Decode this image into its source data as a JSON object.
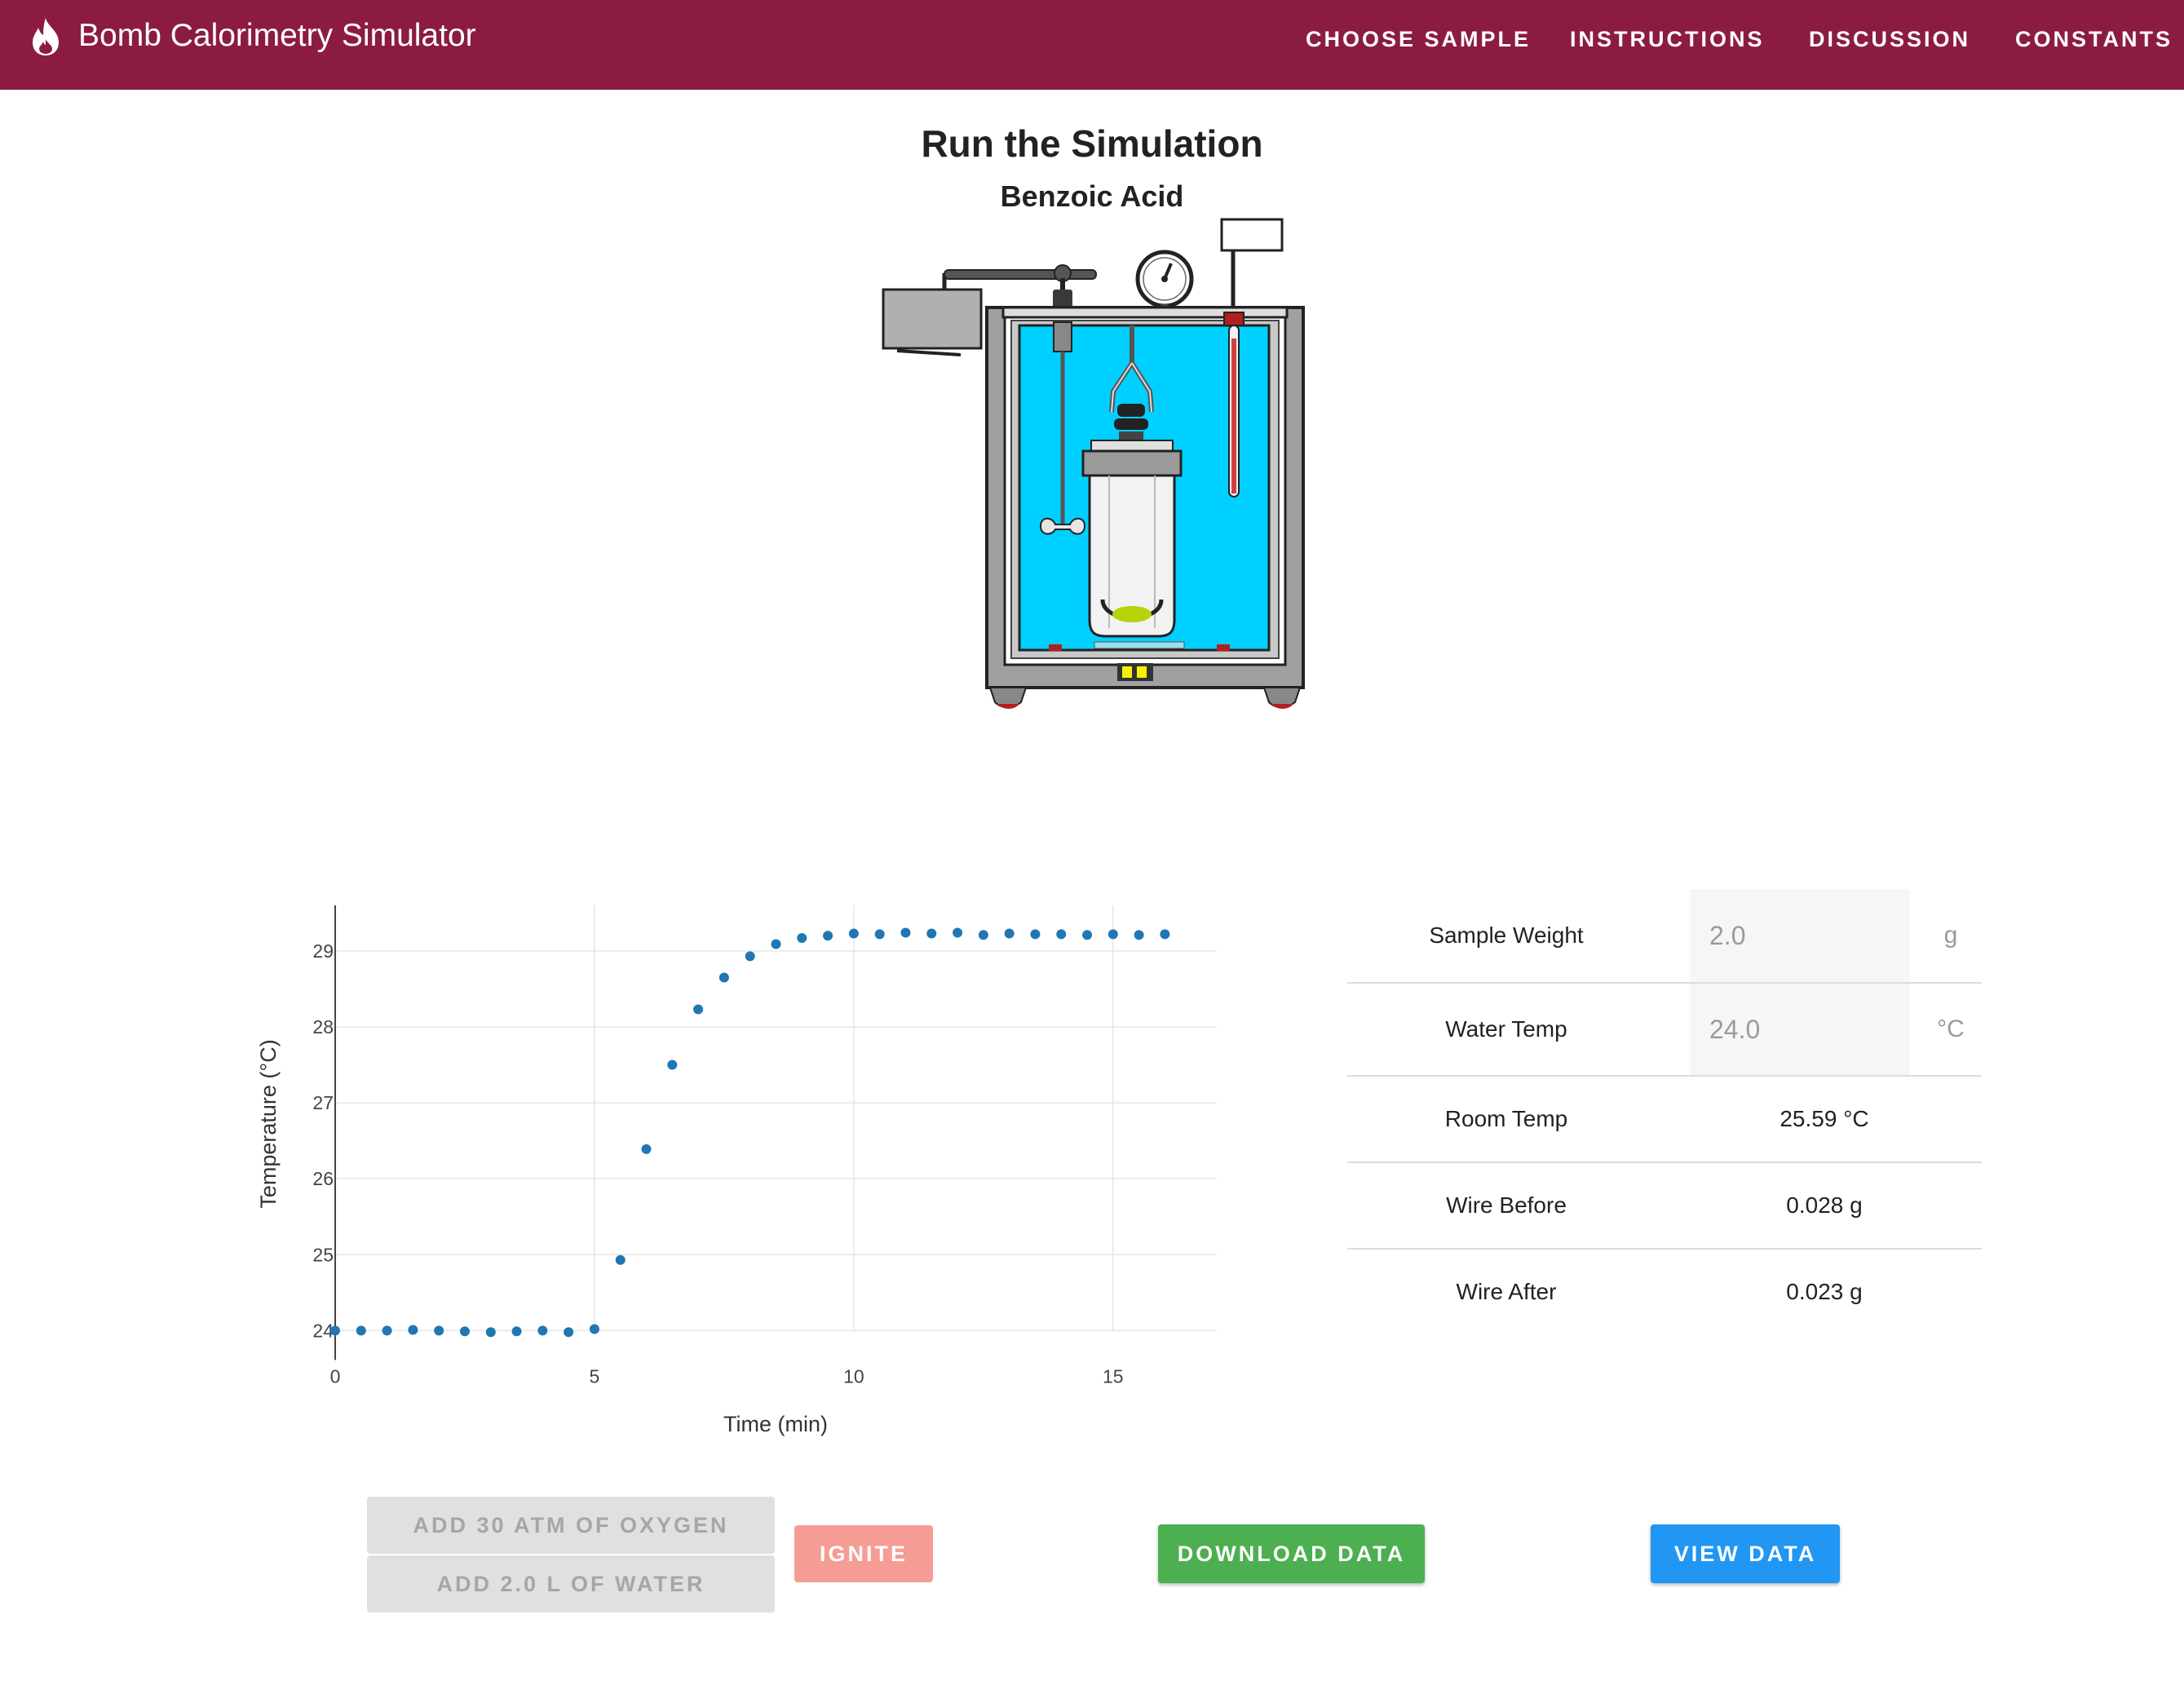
{
  "app": {
    "title": "Bomb Calorimetry Simulator",
    "brand_color": "#8b1c40",
    "logo_icon": "flame-icon"
  },
  "nav": {
    "items": [
      {
        "label": "CHOOSE SAMPLE"
      },
      {
        "label": "INSTRUCTIONS"
      },
      {
        "label": "DISCUSSION"
      },
      {
        "label": "CONSTANTS"
      }
    ]
  },
  "main": {
    "title": "Run the Simulation",
    "sample_name": "Benzoic Acid"
  },
  "chart_data": {
    "type": "scatter",
    "title": "",
    "xlabel": "Time (min)",
    "ylabel": "Temperature (°C)",
    "xlim": [
      0,
      17
    ],
    "ylim": [
      23.8,
      29.6
    ],
    "x_ticks": [
      0,
      5,
      10,
      15
    ],
    "y_ticks": [
      24,
      25,
      26,
      27,
      28,
      29
    ],
    "grid": true,
    "marker_color": "#1f77b4",
    "series": [
      {
        "x": [
          0,
          0.5,
          1,
          1.5,
          2,
          2.5,
          3,
          3.5,
          4,
          4.5,
          5,
          5.5,
          6,
          6.5,
          7,
          7.5,
          8,
          8.5,
          9,
          9.5,
          10,
          10.5,
          11,
          11.5,
          12,
          12.5,
          13,
          13.5,
          14,
          14.5,
          15,
          15.5,
          16
        ],
        "y": [
          24.0,
          24.0,
          24.0,
          24.01,
          24.0,
          23.99,
          23.98,
          23.99,
          24.0,
          23.98,
          24.02,
          24.93,
          26.39,
          27.5,
          28.23,
          28.65,
          28.93,
          29.09,
          29.17,
          29.2,
          29.23,
          29.22,
          29.24,
          29.23,
          29.24,
          29.21,
          29.23,
          29.22,
          29.22,
          29.21,
          29.22,
          29.21,
          29.22
        ]
      }
    ]
  },
  "params": {
    "sample_weight": {
      "label": "Sample Weight",
      "value": "2.0",
      "unit": "g"
    },
    "water_temp": {
      "label": "Water Temp",
      "value": "24.0",
      "unit": "°C"
    },
    "room_temp": {
      "label": "Room Temp",
      "value": "25.59 °C"
    },
    "wire_before": {
      "label": "Wire Before",
      "value": "0.028 g"
    },
    "wire_after": {
      "label": "Wire After",
      "value": "0.023 g"
    }
  },
  "buttons": {
    "add_oxygen": "ADD 30 ATM OF OXYGEN",
    "add_water": "ADD 2.0 L OF WATER",
    "ignite": "IGNITE",
    "download": "DOWNLOAD DATA",
    "view": "VIEW DATA"
  },
  "colors": {
    "water": "#00d0ff",
    "ignite": "#f59d94",
    "download": "#4caf50",
    "view": "#2196f3",
    "sample": "#b6d30a"
  }
}
